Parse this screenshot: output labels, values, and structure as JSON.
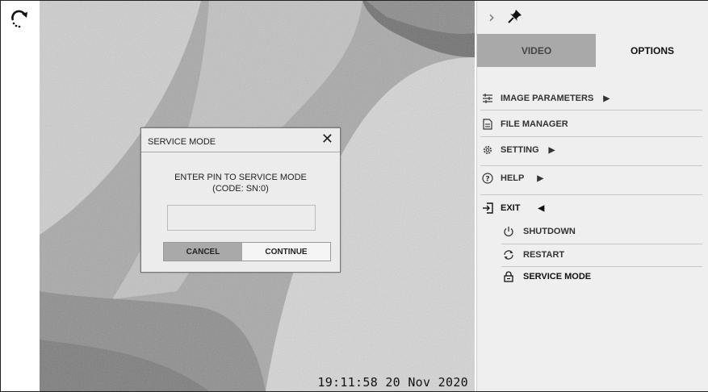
{
  "video": {
    "timestamp": "19:11:58 20 Nov 2020"
  },
  "panel": {
    "tabs": [
      {
        "label": "VIDEO",
        "active": false
      },
      {
        "label": "OPTIONS",
        "active": true
      }
    ],
    "menu": {
      "image_parameters": "IMAGE PARAMETERS",
      "file_manager": "FILE MANAGER",
      "setting": "SETTING",
      "help": "HELP",
      "exit": "EXIT",
      "shutdown": "SHUTDOWN",
      "restart": "RESTART",
      "service_mode": "SERVICE MODE"
    },
    "icons": {
      "collapse": "chevron-right-icon",
      "pin": "pin-icon"
    }
  },
  "dialog": {
    "title": "SERVICE MODE",
    "message_line1": "ENTER PIN TO SERVICE MODE",
    "message_line2": "(CODE:   SN:0)",
    "pin_value": "",
    "cancel_label": "CANCEL",
    "continue_label": "CONTINUE"
  },
  "colors": {
    "panel_bg": "#efefef",
    "active_gray": "#a9a9a9"
  }
}
